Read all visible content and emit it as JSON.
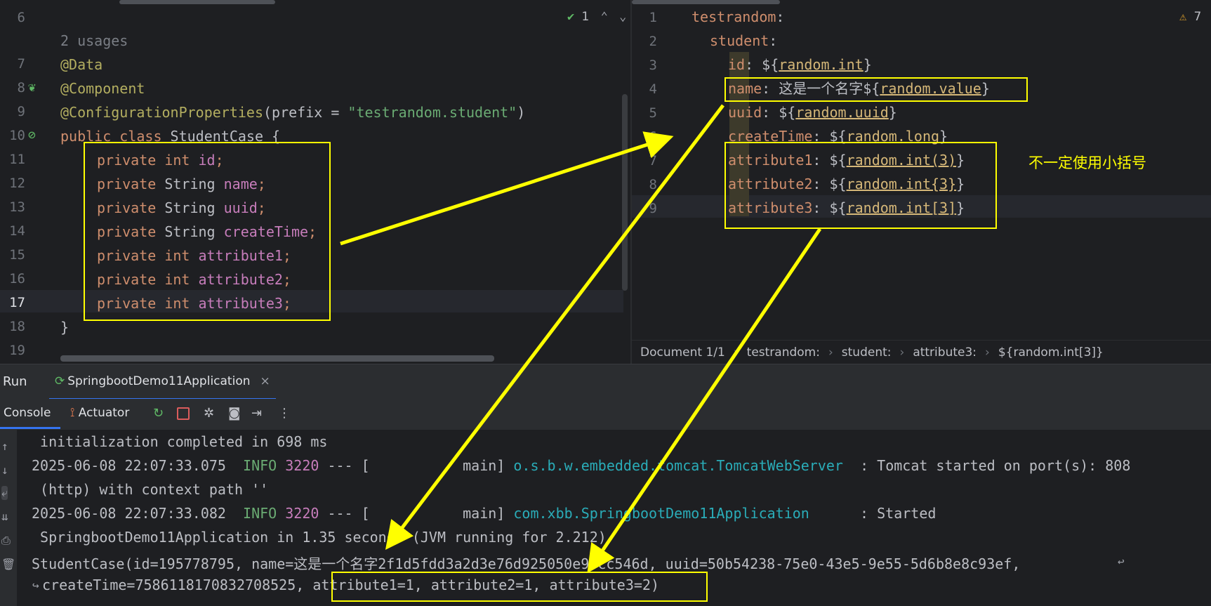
{
  "left_editor": {
    "inspection_count": "1",
    "usages": "2 usages",
    "lines": [
      {
        "n": "6",
        "text": ""
      },
      {
        "n": "7",
        "text": "@Data"
      },
      {
        "n": "8",
        "text": "@Component"
      },
      {
        "n": "9",
        "ann": "@ConfigurationProperties",
        "p1": "(prefix = ",
        "str": "\"testrandom.student\"",
        "p2": ")"
      },
      {
        "n": "10",
        "kw": "public class ",
        "cls": "StudentCase {"
      },
      {
        "n": "11",
        "kw": "private int ",
        "field": "id",
        "semi": ";"
      },
      {
        "n": "12",
        "kw": "private ",
        "type": "String ",
        "field": "name",
        "semi": ";"
      },
      {
        "n": "13",
        "kw": "private ",
        "type": "String ",
        "field": "uuid",
        "semi": ";"
      },
      {
        "n": "14",
        "kw": "private ",
        "type": "String ",
        "field": "createTime",
        "semi": ";"
      },
      {
        "n": "15",
        "kw": "private int ",
        "field": "attribute1",
        "semi": ";"
      },
      {
        "n": "16",
        "kw": "private int ",
        "field": "attribute2",
        "semi": ";"
      },
      {
        "n": "17",
        "kw": "private int ",
        "field": "attribute3",
        "semi": ";"
      },
      {
        "n": "18",
        "text": "}"
      },
      {
        "n": "19",
        "text": ""
      }
    ]
  },
  "right_editor": {
    "warning_count": "7",
    "lines": [
      {
        "n": "1",
        "key": "testrandom",
        "rest": ":"
      },
      {
        "n": "2",
        "key": "student",
        "rest": ":"
      },
      {
        "n": "3",
        "key": "id",
        "pre": ": ${",
        "link": "random.int",
        "post": "}"
      },
      {
        "n": "4",
        "key": "name",
        "pre": ": 这是一个名字${",
        "link": "random.value",
        "post": "}"
      },
      {
        "n": "5",
        "key": "uuid",
        "pre": ": ${",
        "link": "random.uuid",
        "post": "}"
      },
      {
        "n": "6",
        "key": "createTime",
        "pre": ": ${",
        "link": "random.long",
        "post": "}"
      },
      {
        "n": "7",
        "key": "attribute1",
        "pre": ": ${",
        "link": "random.int(3)",
        "post": "}"
      },
      {
        "n": "8",
        "key": "attribute2",
        "pre": ": ${",
        "link": "random.int{3}",
        "post": "}"
      },
      {
        "n": "9",
        "key": "attribute3",
        "pre": ": ${",
        "link": "random.int[3]",
        "post": "}"
      }
    ],
    "note": "不一定使用小括号"
  },
  "breadcrumb": [
    "Document 1/1",
    "testrandom:",
    "student:",
    "attribute3:",
    "${random.int[3]}"
  ],
  "run": {
    "title": "Run",
    "tab": "SpringbootDemo11Application",
    "toolbar_tabs": [
      "Console",
      "Actuator"
    ]
  },
  "console": {
    "l1": " initialization completed in 698 ms",
    "l2_time": "2025-06-08 22:07:33.075  ",
    "l2_level": "INFO",
    "l2_pid": " 3220",
    "l2_mid": " --- [           main] ",
    "l2_logger": "o.s.b.w.embedded.tomcat.TomcatWebServer",
    "l2_msg": "  : Tomcat started on port(s): 808",
    "l3": " (http) with context path ''",
    "l4_time": "2025-06-08 22:07:33.082  ",
    "l4_level": "INFO",
    "l4_pid": " 3220",
    "l4_mid": " --- [           main] ",
    "l4_logger": "com.xbb.SpringbootDemo11Application",
    "l4_msg": "      : Started",
    "l5": " SpringbootDemo11Application in 1.35 seconds (JVM running for 2.212)",
    "l6": "StudentCase(id=195778795, name=这是一个名字2f1d5fdd3a2d3e76d925050e9bcc546d, uuid=50b54238-75e0-43e5-9e55-5d6b8e8c93ef,",
    "l7": "createTime=7586118170832708525, attribute1=1, attribute2=1, attribute3=2)"
  },
  "colors": {
    "annotation_box": "#ffff00",
    "keyword": "#cf8e6d",
    "string": "#6aab73",
    "field": "#c77dbb"
  }
}
